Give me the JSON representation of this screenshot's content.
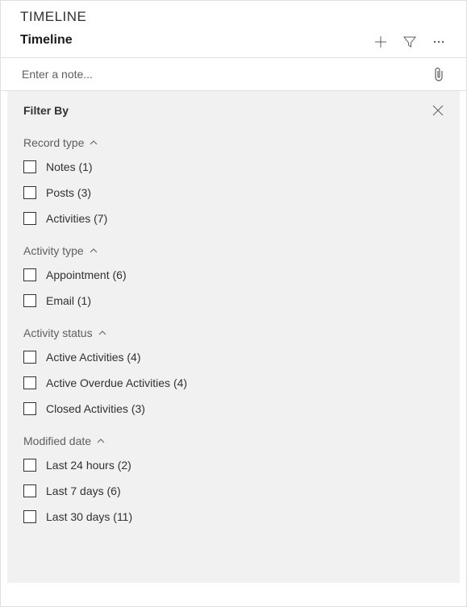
{
  "header": {
    "title": "TIMELINE",
    "subtitle": "Timeline"
  },
  "note": {
    "placeholder": "Enter a note..."
  },
  "filter": {
    "title": "Filter By",
    "groups": [
      {
        "label": "Record type",
        "options": [
          {
            "label": "Notes (1)"
          },
          {
            "label": "Posts (3)"
          },
          {
            "label": "Activities (7)"
          }
        ]
      },
      {
        "label": "Activity type",
        "options": [
          {
            "label": "Appointment (6)"
          },
          {
            "label": "Email (1)"
          }
        ]
      },
      {
        "label": "Activity status",
        "options": [
          {
            "label": "Active Activities (4)"
          },
          {
            "label": "Active Overdue Activities (4)"
          },
          {
            "label": "Closed Activities (3)"
          }
        ]
      },
      {
        "label": "Modified date",
        "options": [
          {
            "label": "Last 24 hours (2)"
          },
          {
            "label": "Last 7 days (6)"
          },
          {
            "label": "Last 30 days (11)"
          }
        ]
      }
    ]
  }
}
